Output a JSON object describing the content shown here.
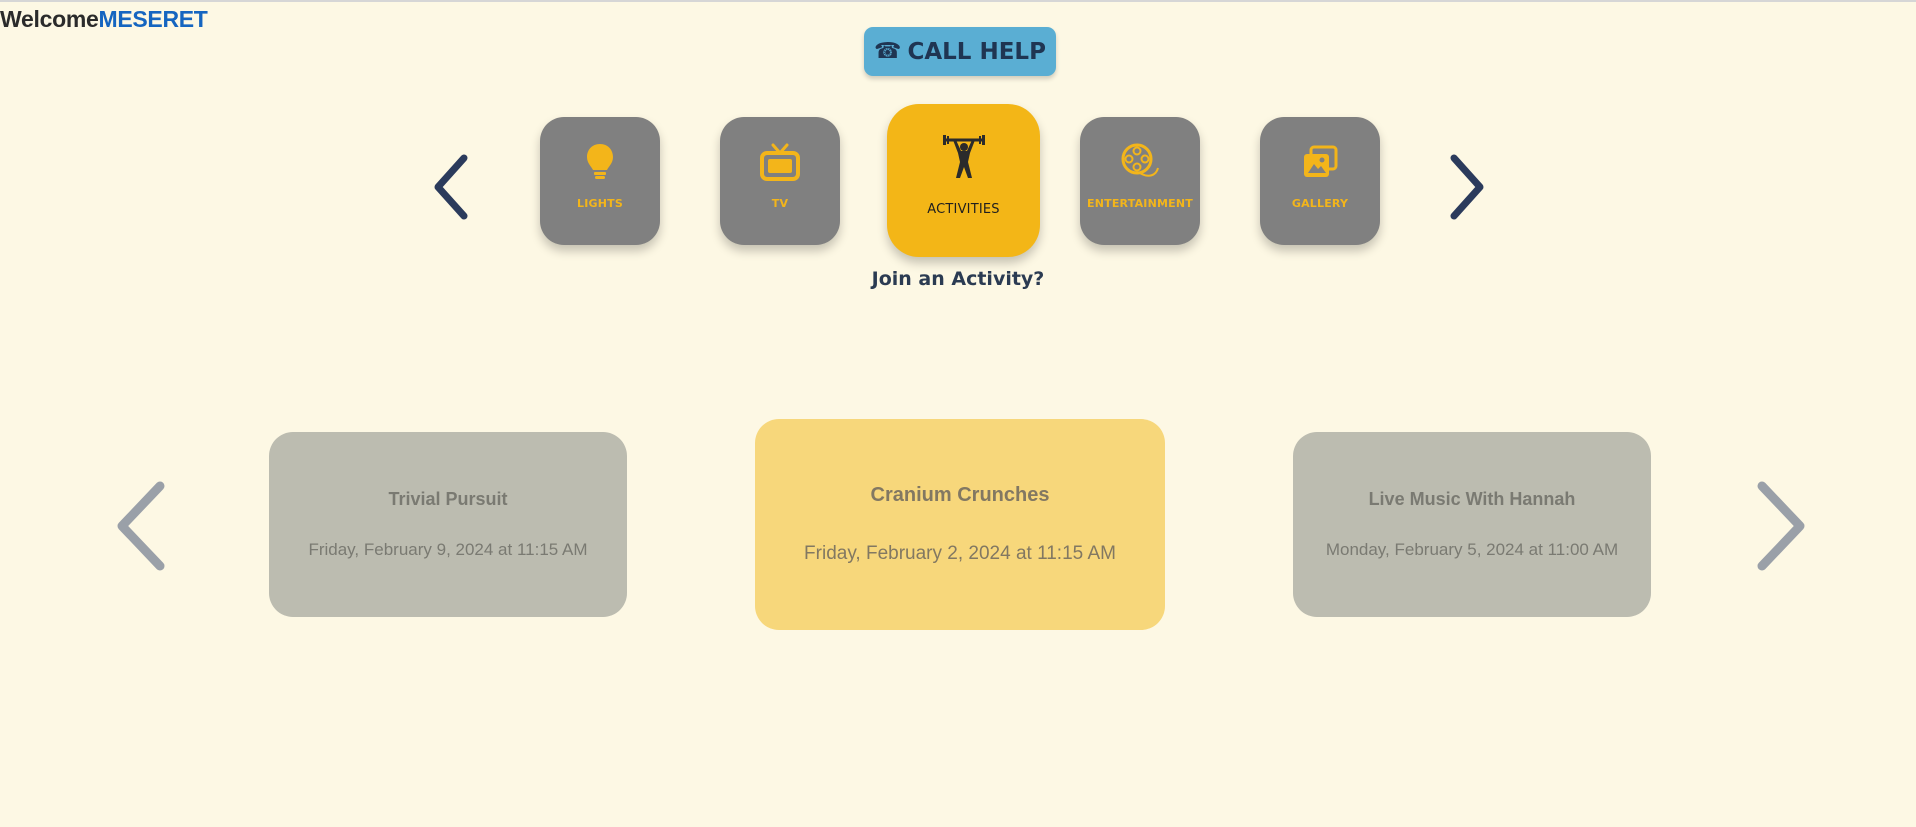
{
  "header": {
    "welcome_text": "Welcome",
    "user_name": "MESERET"
  },
  "call_help": {
    "icon": "phone-icon",
    "label": "CALL HELP"
  },
  "categories": {
    "items": [
      {
        "label": "LIGHTS",
        "icon": "lightbulb-icon"
      },
      {
        "label": "TV",
        "icon": "tv-icon"
      },
      {
        "label": "ACTIVITIES",
        "icon": "weightlifter-icon",
        "active": true
      },
      {
        "label": "ENTERTAINMENT",
        "icon": "film-reel-icon"
      },
      {
        "label": "GALLERY",
        "icon": "gallery-icon"
      }
    ],
    "prompt": "Join an Activity?"
  },
  "activities": [
    {
      "title": "Trivial Pursuit",
      "date": "Friday, February 9, 2024 at 11:15 AM"
    },
    {
      "title": "Cranium Crunches",
      "date": "Friday, February 2, 2024 at 11:15 AM",
      "selected": true
    },
    {
      "title": "Live Music With Hannah",
      "date": "Monday, February 5, 2024 at 11:00 AM"
    }
  ],
  "colors": {
    "background": "#fdf8e4",
    "accent": "#f3b617",
    "user_name": "#1565c0",
    "call_help_bg": "#5aaed3",
    "tile_bg": "#808080",
    "nav_arrow": "#2b3b5c",
    "card_bg": "#bcbcb0",
    "card_selected_bg": "#f7d77b"
  }
}
